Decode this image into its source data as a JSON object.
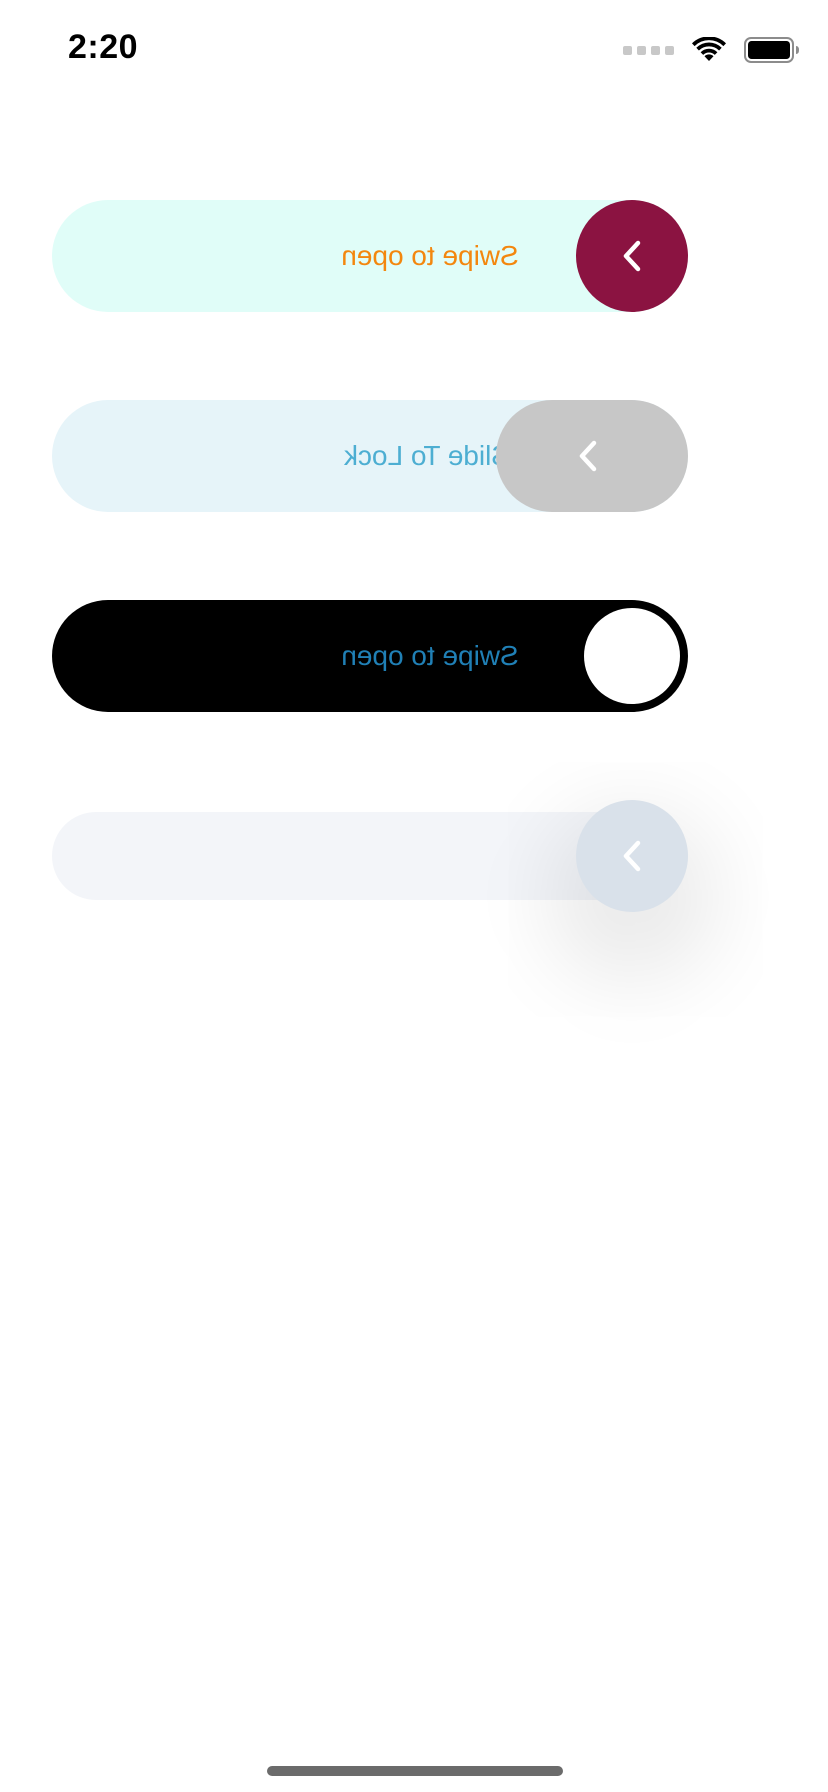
{
  "status_bar": {
    "time": "2:20"
  },
  "sliders": [
    {
      "label": "Swipe to open",
      "track_color": "#e0fdf8",
      "text_color": "#f3870e",
      "knob_color": "#8b1341",
      "knob_icon": "chevron-left-icon"
    },
    {
      "label": "Slide To Lock",
      "track_color": "#e6f4f9",
      "text_color": "#4daed2",
      "knob_color": "#c7c7c7",
      "knob_icon": "chevron-left-icon"
    },
    {
      "label": "Swipe to open",
      "track_color": "#000000",
      "text_color": "#2080b6",
      "knob_color": "#ffffff",
      "knob_icon": "none"
    },
    {
      "label": "",
      "track_color": "#f3f5f9",
      "knob_color": "#d9e1ea",
      "knob_icon": "chevron-left-icon"
    }
  ]
}
